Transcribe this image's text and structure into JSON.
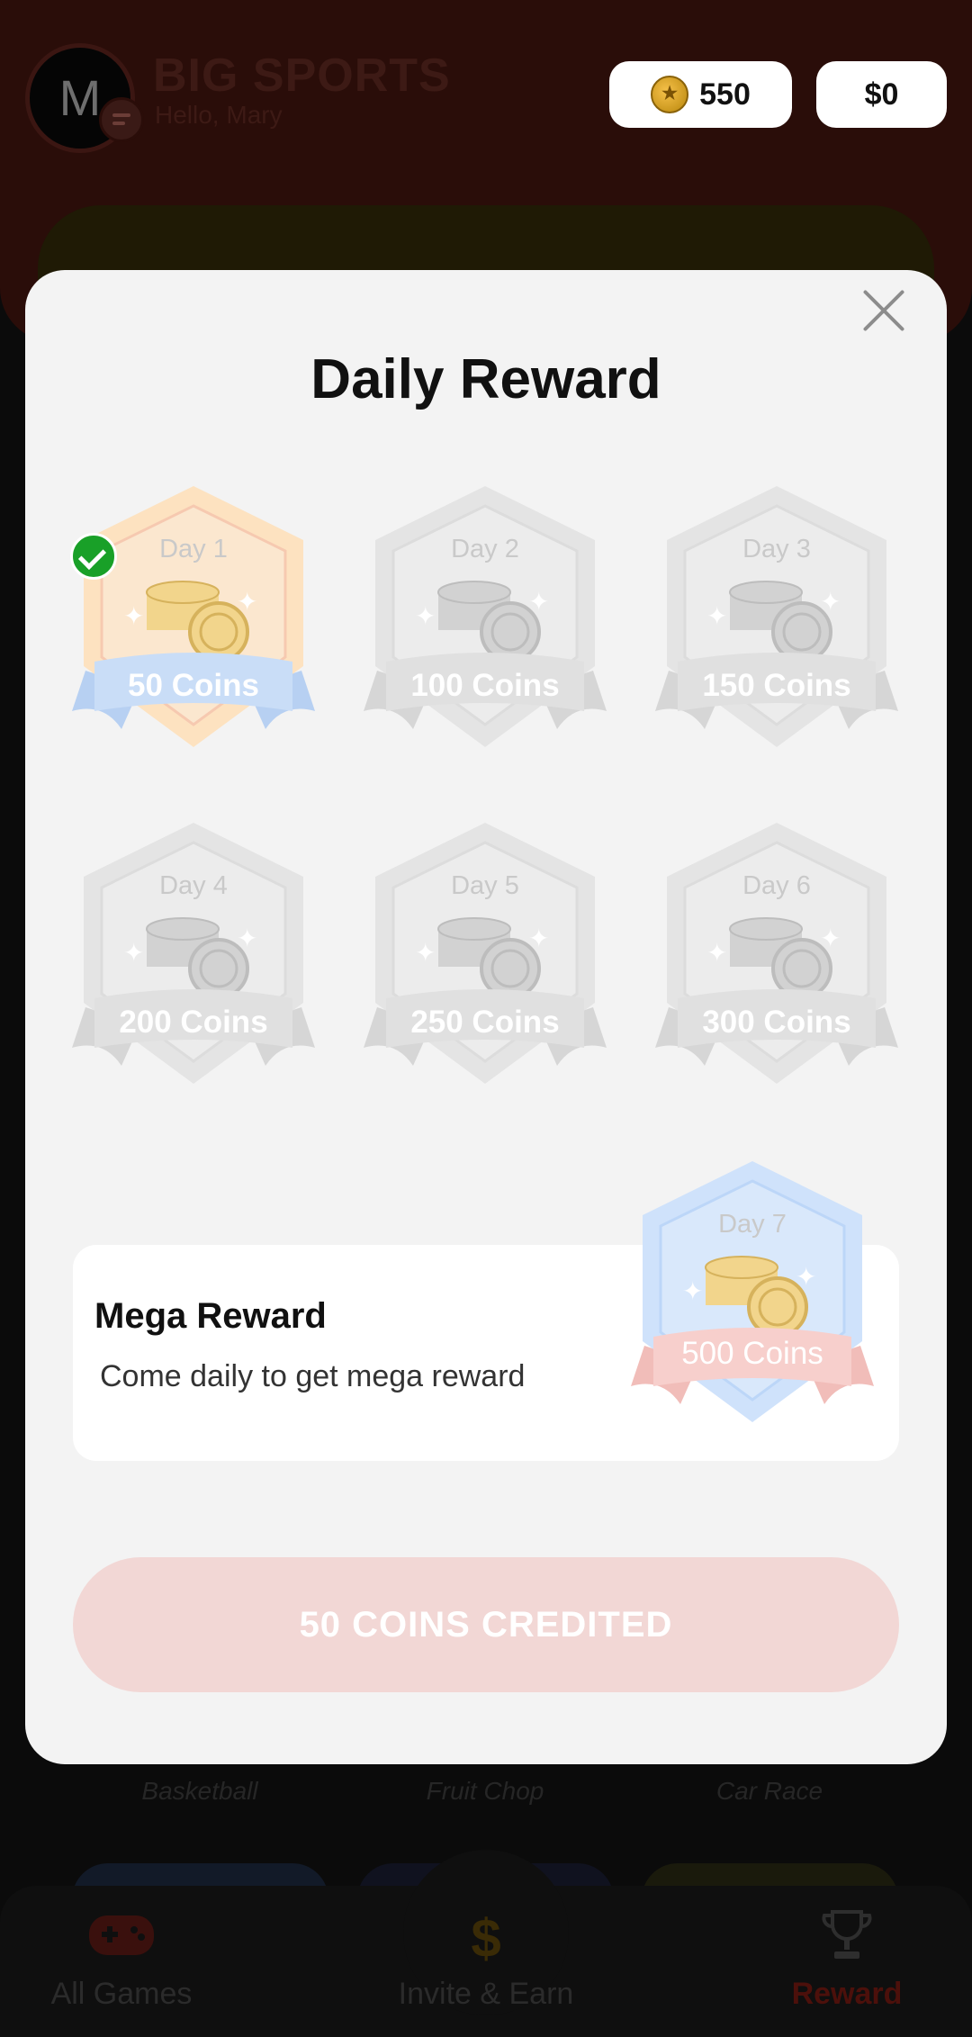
{
  "header": {
    "avatar_initial": "M",
    "app_title": "BIG SPORTS",
    "greeting": "Hello, Mary",
    "coin_balance": "550",
    "cash_balance": "$0"
  },
  "background_games": {
    "labels": [
      "Basketball",
      "Fruit Chop",
      "Car Race"
    ]
  },
  "bottom_nav": {
    "items": [
      {
        "label": "All Games",
        "icon": "gamepad-icon"
      },
      {
        "label": "Invite & Earn",
        "icon": "dollar-icon"
      },
      {
        "label": "Reward",
        "icon": "trophy-icon",
        "active": true
      }
    ]
  },
  "modal": {
    "title": "Daily Reward",
    "days": [
      {
        "day": "Day 1",
        "amount": "50 Coins",
        "claimed": true
      },
      {
        "day": "Day 2",
        "amount": "100 Coins",
        "claimed": false
      },
      {
        "day": "Day 3",
        "amount": "150 Coins",
        "claimed": false
      },
      {
        "day": "Day 4",
        "amount": "200 Coins",
        "claimed": false
      },
      {
        "day": "Day 5",
        "amount": "250 Coins",
        "claimed": false
      },
      {
        "day": "Day 6",
        "amount": "300 Coins",
        "claimed": false
      }
    ],
    "mega": {
      "title": "Mega Reward",
      "subtitle": "Come daily to get mega reward",
      "day": "Day 7",
      "amount": "500 Coins"
    },
    "button_label": "50 COINS CREDITED"
  },
  "colors": {
    "claimed_green": "#19a028",
    "reward_active": "#4c100b",
    "button_bg": "#f2d7d5"
  }
}
